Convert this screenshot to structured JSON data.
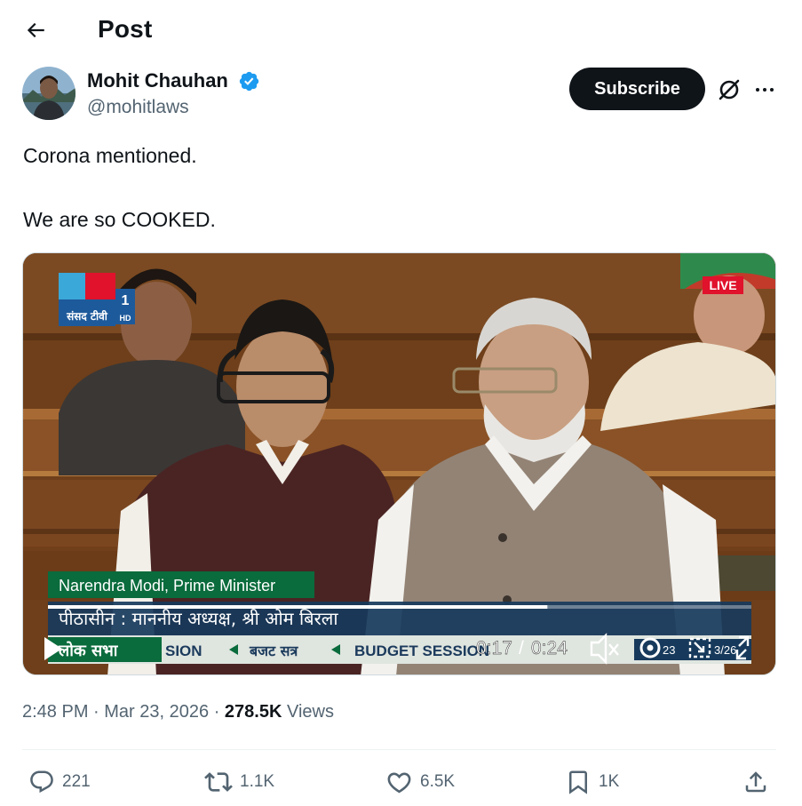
{
  "header": {
    "title": "Post"
  },
  "author": {
    "name": "Mohit Chauhan",
    "handle": "@mohitlaws"
  },
  "actions_top": {
    "subscribe_label": "Subscribe"
  },
  "tweet": {
    "line1": "Corona mentioned.",
    "line2": "We are so COOKED."
  },
  "video": {
    "channel_text": "संसद टीवी",
    "channel_number": "1",
    "channel_hd": "HD",
    "live_label": "LIVE",
    "speaker_caption": "Narendra Modi, Prime Minister",
    "chair_caption": "पीठासीन : माननीय अध्यक्ष, श्री ओम बिरला",
    "ticker_lok_sabha": "लोक सभा",
    "ticker_items": [
      "SION",
      "बजट सत्र",
      "BUDGET SESSION"
    ],
    "ticker_date_fragment": "23",
    "ticker_date_fragment2": "3/26",
    "time_current": "0:17",
    "time_total": "0:24",
    "progress": 0.71
  },
  "meta": {
    "time": "2:48 PM",
    "date": "Mar 23, 2026",
    "views_count": "278.5K",
    "views_label": "Views"
  },
  "stats": {
    "replies": "221",
    "reposts": "1.1K",
    "likes": "6.5K",
    "bookmarks": "1K"
  },
  "colors": {
    "verified": "#1d9bf0",
    "text": "#0f1419",
    "secondary": "#536471",
    "ticker_green": "#0a6b3c",
    "live_red": "#e0122c"
  }
}
